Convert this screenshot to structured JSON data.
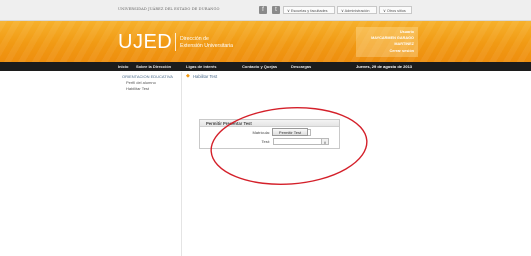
{
  "topbar": {
    "university": "UNIVERSIDAD JUÁREZ DEL ESTADO DE DURANGO",
    "social_facebook": "f",
    "social_twitter": "t",
    "menu_escuelas": "Escuelas y facultades",
    "menu_admin": "Administración",
    "menu_otros": "Otros sitios"
  },
  "header": {
    "logo": "UJED",
    "dept_line1": "Dirección de",
    "dept_line2": "Extensión Universitaria",
    "login_line1": "Usuario",
    "login_line2": "MAYCARMEN GARAGO",
    "login_line3": "MARTINEZ",
    "login_line4": "Cerrar sesión"
  },
  "nav": {
    "items": [
      "Inicio",
      "Sobre la Dirección",
      "Ligas de interés",
      "Contacto y Quejas",
      "Descargas"
    ],
    "date": "Jueves, 29 de agosto de 2013"
  },
  "sidebar": {
    "title": "ORIENTACION EDUCATIVA",
    "links": [
      "Perfil del alumno",
      "Habilitar Test"
    ]
  },
  "breadcrumb": {
    "label": "Habilitar Test"
  },
  "panel": {
    "title": "Permitir Presentar Test",
    "matricula_label": "Matrícula:",
    "matricula_value": "",
    "test_label": "Test:",
    "test_value": "",
    "button_label": "Permitir Test"
  },
  "colors": {
    "header_orange": "#f19a14",
    "nav_black": "#1c1c1c",
    "annotation_red": "#d4202a"
  }
}
